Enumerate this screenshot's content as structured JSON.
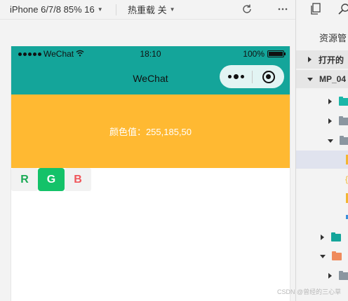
{
  "toolbar": {
    "device_label": "iPhone 6/7/8 85% 16",
    "hot_reload_label": "热重载 关",
    "icons": [
      "refresh-icon",
      "more-icon",
      "files-icon",
      "search-icon"
    ]
  },
  "phone": {
    "carrier": "WeChat",
    "time": "18:10",
    "battery": "100%",
    "nav_title": "WeChat",
    "color_text": "颜色值：255,185,50",
    "color_hex": "#ffb932",
    "nav_color": "#14a59a",
    "buttons": [
      {
        "label": "R",
        "color": "#1aaa55",
        "selected": false
      },
      {
        "label": "G",
        "color": "#ffffff",
        "selected": true
      },
      {
        "label": "B",
        "color": "#f0555a",
        "selected": false
      }
    ]
  },
  "explorer": {
    "title": "资源管",
    "section_open": "打开的",
    "section_project": "MP_04"
  },
  "watermark": "CSDN @曾经的三心草"
}
